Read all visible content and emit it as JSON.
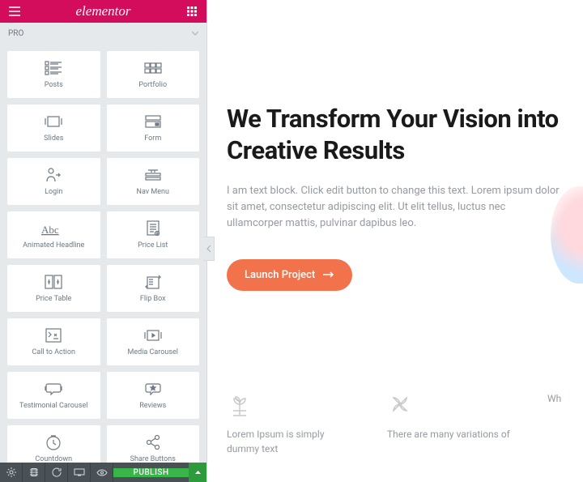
{
  "panel": {
    "logo": "elementor",
    "category": "PRO",
    "widgets": [
      {
        "label": "Posts",
        "icon": "posts"
      },
      {
        "label": "Portfolio",
        "icon": "portfolio"
      },
      {
        "label": "Slides",
        "icon": "slides"
      },
      {
        "label": "Form",
        "icon": "form"
      },
      {
        "label": "Login",
        "icon": "login"
      },
      {
        "label": "Nav Menu",
        "icon": "navmenu"
      },
      {
        "label": "Animated Headline",
        "icon": "headline"
      },
      {
        "label": "Price List",
        "icon": "pricelist"
      },
      {
        "label": "Price Table",
        "icon": "pricetable"
      },
      {
        "label": "Flip Box",
        "icon": "flipbox"
      },
      {
        "label": "Call to Action",
        "icon": "cta"
      },
      {
        "label": "Media Carousel",
        "icon": "mediacarousel"
      },
      {
        "label": "Testimonial Carousel",
        "icon": "testimonial"
      },
      {
        "label": "Reviews",
        "icon": "reviews"
      },
      {
        "label": "Countdown",
        "icon": "countdown"
      },
      {
        "label": "Share Buttons",
        "icon": "share"
      }
    ],
    "publish": "PUBLISH"
  },
  "preview": {
    "title": "We Transform Your Vision into Creative Results",
    "body": "I am text block. Click edit button to change this text. Lorem ipsum dolor sit amet, consectetur adipiscing elit. Ut elit tellus, luctus nec ullamcorper mattis, pulvinar dapibus leo.",
    "cta": "Launch Project",
    "features": [
      {
        "text": "Lorem Ipsum is simply dummy text"
      },
      {
        "text": "There are many variations of"
      },
      {
        "text": "Wh"
      }
    ]
  }
}
